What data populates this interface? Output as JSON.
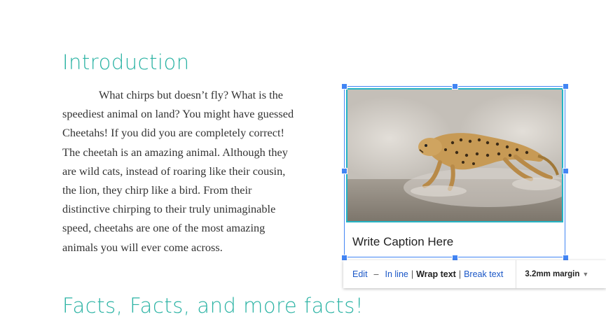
{
  "document": {
    "intro_heading": "Introduction",
    "paragraph_lines": [
      "What chirps but doesn’t fly? What is the",
      "speediest animal on land? You might have guessed",
      "Cheetahs! If you did you are completely correct!",
      "The cheetah is an amazing animal. Although they",
      "are wild cats, instead of roaring like their cousin,",
      "the lion, they chirp like a bird. From their",
      "distinctive chirping to their truly unimaginable",
      "speed, cheetahs are one of the most amazing",
      "animals you will ever come across."
    ],
    "facts_heading": "Facts, Facts, and more facts!"
  },
  "image": {
    "subject": "running cheetah photo",
    "caption": "Write Caption Here",
    "colors": {
      "selection": "#4285f4",
      "border": "#24b4c4"
    }
  },
  "toolbar": {
    "edit": "Edit",
    "dash": "–",
    "in_line": "In line",
    "separator": "|",
    "wrap_text": "Wrap text",
    "break_text": "Break text",
    "margin": "3.2mm margin"
  },
  "colors": {
    "heading": "#2bb3a4",
    "link": "#1a57c7",
    "text": "#333333"
  }
}
